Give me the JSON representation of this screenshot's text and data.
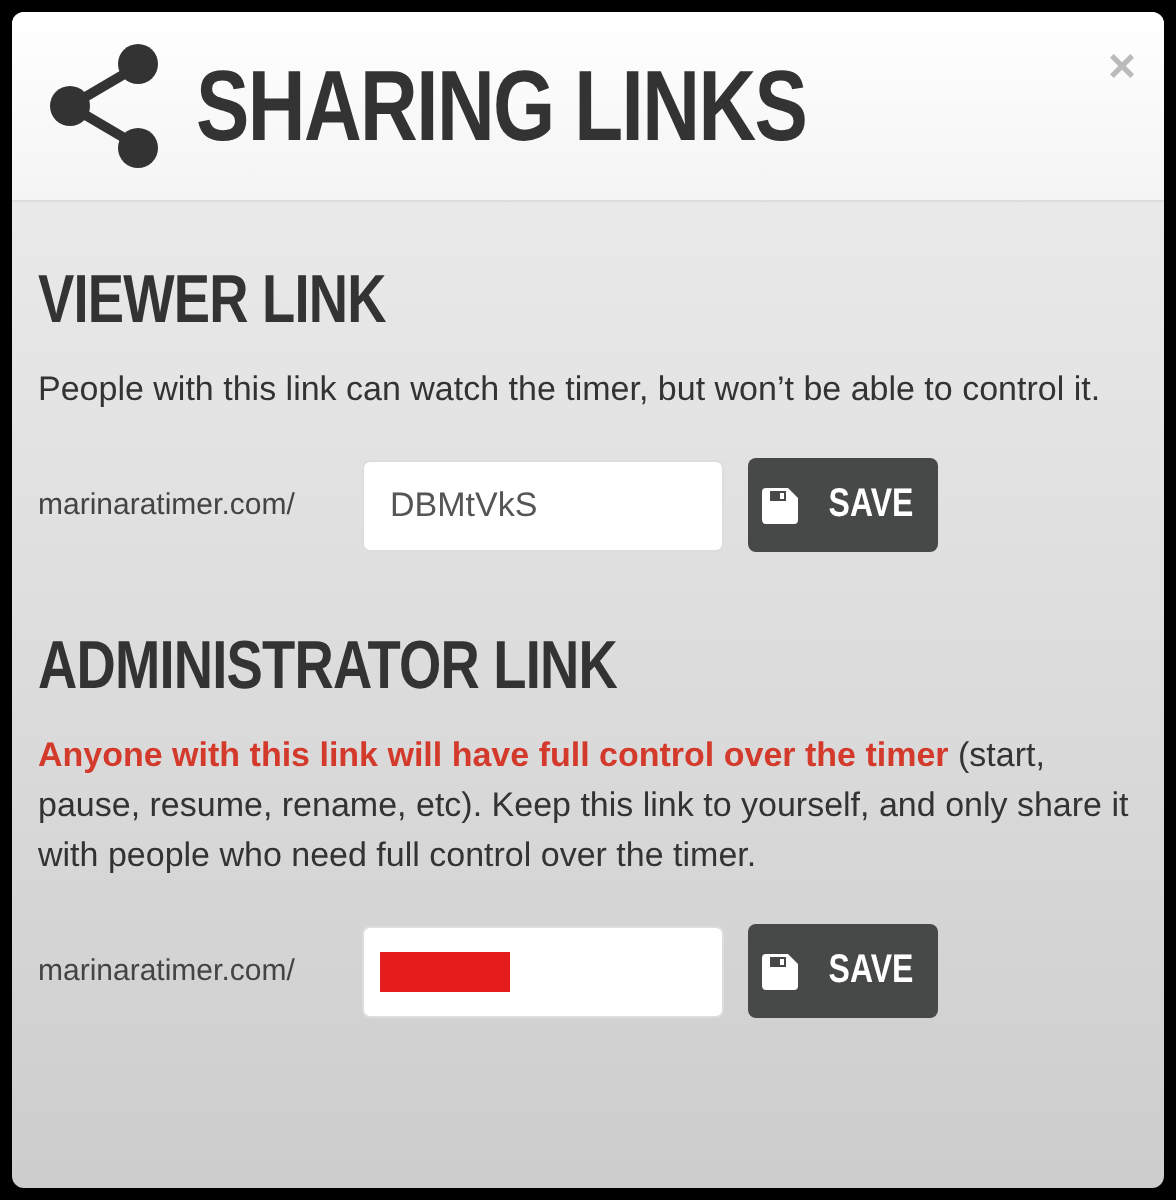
{
  "dialog": {
    "title": "SHARING LINKS",
    "close": "×"
  },
  "sections": [
    {
      "heading": "VIEWER LINK",
      "description": "People with this link can watch the timer, but won’t be able to control it.",
      "prefix": "marinaratimer.com/",
      "value": "DBMtVkS",
      "redacted": false,
      "button": "SAVE"
    },
    {
      "heading": "ADMINISTRATOR LINK",
      "warning": "Anyone with this link will have full control over the timer",
      "description": " (start, pause, resume, rename, etc). Keep this link to yourself, and only share it with people who need full control over the timer.",
      "prefix": "marinaratimer.com/",
      "redacted": true,
      "button": "SAVE"
    }
  ]
}
